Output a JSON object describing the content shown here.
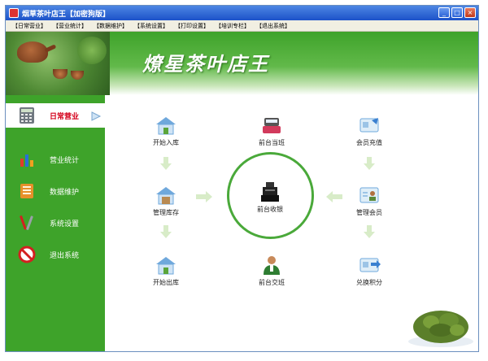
{
  "window": {
    "title": "烟草茶叶店王【加密狗版】",
    "min_symbol": "_",
    "max_symbol": "□",
    "close_symbol": "×"
  },
  "menu": [
    "【日常营业】",
    "【营业统计】",
    "【数据维护】",
    "【系统设置】",
    "【打印设置】",
    "【培训专栏】",
    "【退出系统】"
  ],
  "header": {
    "brand": "燎星茶叶店王"
  },
  "sidebar": {
    "items": [
      {
        "label": "日常营业",
        "icon": "calculator-icon",
        "active": true
      },
      {
        "label": "营业统计",
        "icon": "bar-chart-icon",
        "active": false
      },
      {
        "label": "数据维护",
        "icon": "notebook-icon",
        "active": false
      },
      {
        "label": "系统设置",
        "icon": "tools-icon",
        "active": false
      },
      {
        "label": "退出系统",
        "icon": "no-entry-icon",
        "active": false
      }
    ]
  },
  "functions": {
    "stock_in": {
      "label": "开始入库",
      "icon": "house-in-icon"
    },
    "front_on_duty": {
      "label": "前台当班",
      "icon": "cashier-icon"
    },
    "member_recharge": {
      "label": "会员充值",
      "icon": "card-recharge-icon"
    },
    "inventory": {
      "label": "管理库存",
      "icon": "house-stock-icon"
    },
    "front_cashier": {
      "label": "前台收银",
      "icon": "cash-register-icon"
    },
    "manage_members": {
      "label": "管理会员",
      "icon": "member-card-icon"
    },
    "stock_out": {
      "label": "开始出库",
      "icon": "house-out-icon"
    },
    "front_handover": {
      "label": "前台交班",
      "icon": "staff-icon"
    },
    "redeem_points": {
      "label": "兑换积分",
      "icon": "card-points-icon"
    }
  },
  "colors": {
    "brand_green": "#3ea32a",
    "active_red": "#d4001a",
    "title_blue": "#1c52c9"
  }
}
